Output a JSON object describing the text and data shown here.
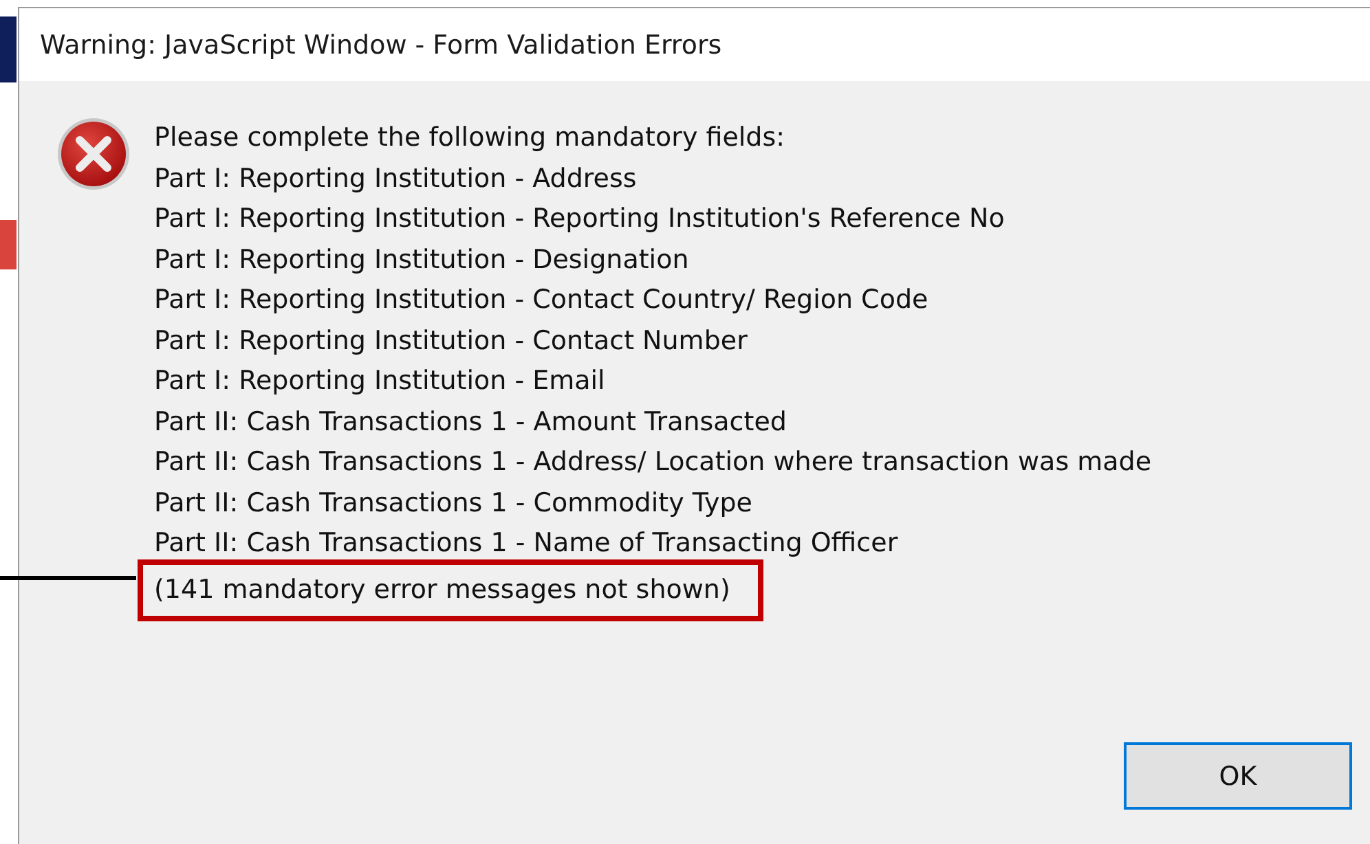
{
  "window": {
    "title": "Warning: JavaScript Window - Form Validation Errors"
  },
  "message": {
    "kind": "error",
    "heading": "Please complete the following mandatory fields:",
    "fields": [
      "Part I: Reporting Institution - Address",
      "Part I: Reporting Institution - Reporting Institution's Reference No",
      "Part I: Reporting Institution - Designation",
      "Part I: Reporting Institution - Contact Country/ Region Code",
      "Part I: Reporting Institution - Contact Number",
      "Part I: Reporting Institution - Email",
      "Part II: Cash Transactions 1 - Amount Transacted",
      "Part II: Cash Transactions 1 - Address/ Location where transaction was made",
      "Part II: Cash Transactions 1 - Commodity Type",
      "Part II: Cash Transactions 1 - Name of Transacting Officer"
    ],
    "note": {
      "text": "(141 mandatory error messages not shown)",
      "highlighted": true
    }
  },
  "buttons": [
    {
      "label": "OK",
      "focused": true
    }
  ]
}
